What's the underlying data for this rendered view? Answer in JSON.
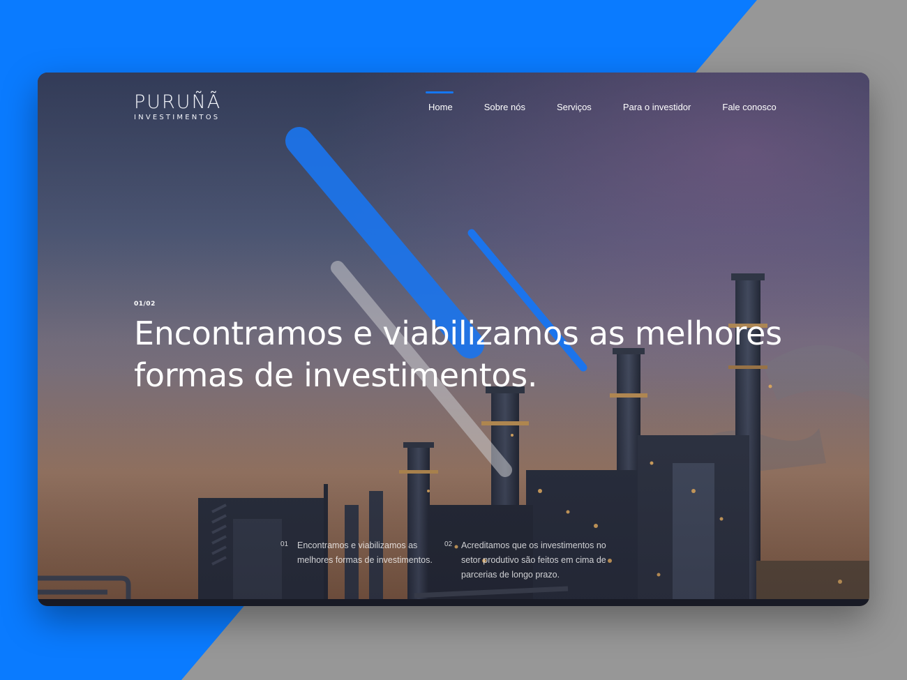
{
  "brand": {
    "name": "PURUÑÃ",
    "tagline": "INVESTIMENTOS"
  },
  "nav": {
    "items": [
      {
        "label": "Home",
        "active": true
      },
      {
        "label": "Sobre nós",
        "active": false
      },
      {
        "label": "Serviços",
        "active": false
      },
      {
        "label": "Para o investidor",
        "active": false
      },
      {
        "label": "Fale conosco",
        "active": false
      }
    ]
  },
  "hero": {
    "counter": "01/02",
    "headline_line1": "Encontramos e viabilizamos as melhores",
    "headline_line2": "formas de investimentos."
  },
  "features": [
    {
      "number": "01",
      "text": "Encontramos e viabilizamos as melhores formas de investimentos."
    },
    {
      "number": "02",
      "text": "Acreditamos que os investimentos no setor produtivo são feitos em cima de parcerias de longo prazo."
    }
  ],
  "colors": {
    "accent": "#1577f2",
    "backdrop_blue": "#0a7bff",
    "backdrop_grey": "#979797"
  }
}
